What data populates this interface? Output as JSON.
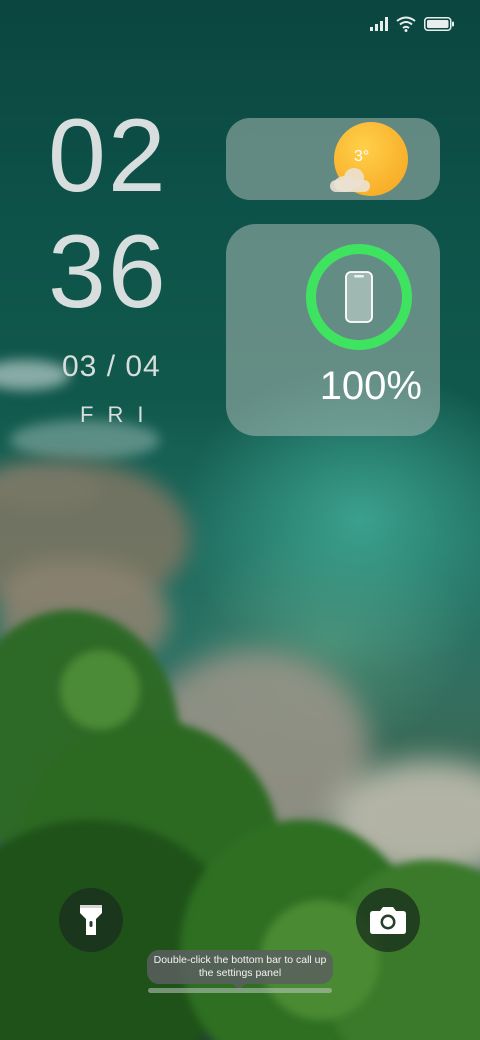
{
  "status_bar": {
    "signal_icon": "cellular-signal-icon",
    "wifi_icon": "wifi-icon",
    "battery_icon": "battery-icon"
  },
  "clock": {
    "hour": "02",
    "minute": "36",
    "date": "03 / 04",
    "weekday": "FRI"
  },
  "weather_widget": {
    "temperature": "3°",
    "icon": "sun-with-cloud-icon"
  },
  "battery_widget": {
    "percent_label": "100%",
    "level": 1.0,
    "ring_color": "#3ee35f",
    "icon": "phone-icon"
  },
  "shortcuts": {
    "left_icon": "flashlight-icon",
    "right_icon": "camera-icon"
  },
  "hint": {
    "text": "Double-click the bottom bar to call up the settings panel"
  }
}
